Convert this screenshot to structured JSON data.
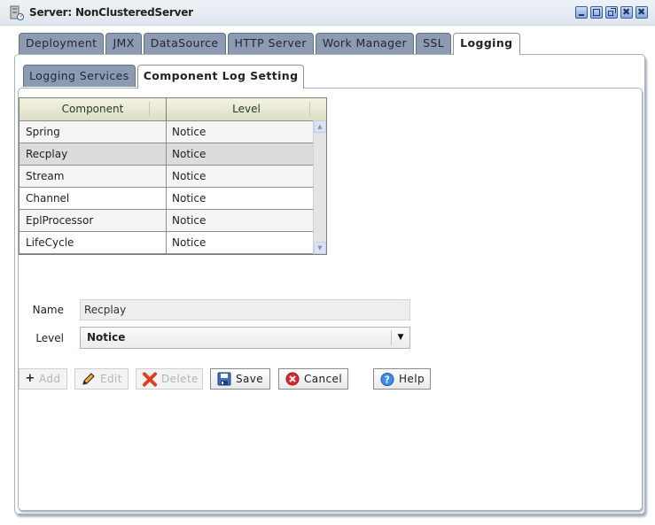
{
  "window": {
    "title": "Server: NonClusteredServer",
    "controls": [
      "minimize",
      "maximize",
      "restore",
      "close-inner",
      "close"
    ]
  },
  "tabs": [
    {
      "label": "Deployment",
      "active": false
    },
    {
      "label": "JMX",
      "active": false
    },
    {
      "label": "DataSource",
      "active": false
    },
    {
      "label": "HTTP Server",
      "active": false
    },
    {
      "label": "Work Manager",
      "active": false
    },
    {
      "label": "SSL",
      "active": false
    },
    {
      "label": "Logging",
      "active": true
    }
  ],
  "subtabs": [
    {
      "label": "Logging Services",
      "active": false
    },
    {
      "label": "Component Log Setting",
      "active": true
    }
  ],
  "grid": {
    "columns": [
      "Component",
      "Level"
    ],
    "rows": [
      {
        "component": "Spring",
        "level": "Notice"
      },
      {
        "component": "Recplay",
        "level": "Notice",
        "selected": true
      },
      {
        "component": "Stream",
        "level": "Notice"
      },
      {
        "component": "Channel",
        "level": "Notice"
      },
      {
        "component": "EplProcessor",
        "level": "Notice"
      },
      {
        "component": "LifeCycle",
        "level": "Notice"
      }
    ]
  },
  "form": {
    "name_label": "Name",
    "name_value": "Recplay",
    "level_label": "Level",
    "level_value": "Notice"
  },
  "buttons": {
    "add": "Add",
    "edit": "Edit",
    "delete": "Delete",
    "save": "Save",
    "cancel": "Cancel",
    "help": "Help"
  }
}
